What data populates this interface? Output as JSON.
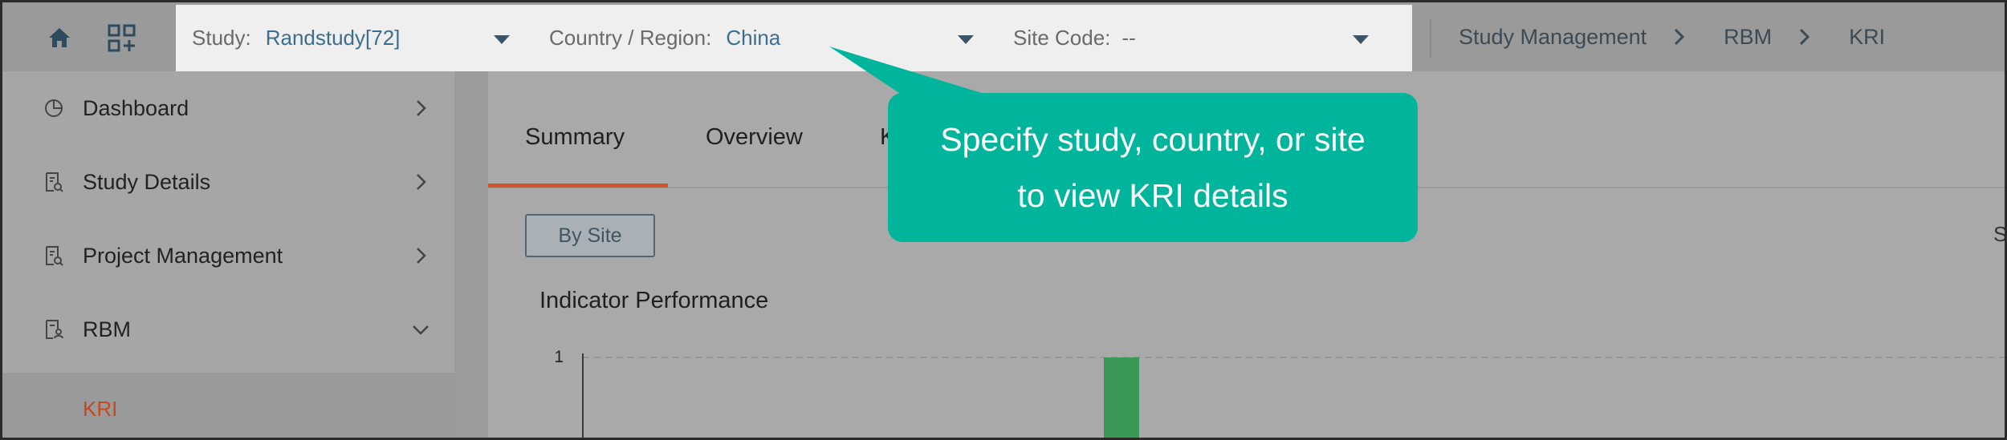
{
  "filters": {
    "study_label": "Study:",
    "study_value": "Randstudy[72]",
    "country_label": "Country / Region:",
    "country_value": "China",
    "site_label": "Site Code:",
    "site_value": "--"
  },
  "breadcrumb": [
    "Study Management",
    "RBM",
    "KRI"
  ],
  "sidebar": {
    "items": [
      {
        "label": "Dashboard",
        "icon": "pie-chart-icon",
        "expanded": false
      },
      {
        "label": "Study Details",
        "icon": "document-search-icon",
        "expanded": false
      },
      {
        "label": "Project Management",
        "icon": "document-search-icon",
        "expanded": false
      },
      {
        "label": "RBM",
        "icon": "document-user-icon",
        "expanded": true
      }
    ],
    "sub_item": "KRI"
  },
  "tabs": [
    {
      "label": "Summary",
      "active": true
    },
    {
      "label": "Overview",
      "active": false
    },
    {
      "label": "K",
      "active": false
    }
  ],
  "by_site_button": "By Site",
  "section_title": "Indicator Performance",
  "tooltip": {
    "line1": "Specify study, country, or site",
    "line2": "to view KRI details"
  },
  "edge_text": "S",
  "colors": {
    "accent": "#d3542a",
    "tooltip": "#00b59b",
    "link": "#3b6e8f",
    "bar": "#3a9a55"
  },
  "chart_data": {
    "type": "bar",
    "y_ticks": [
      "1"
    ],
    "ylim": [
      0,
      1
    ],
    "bars": [
      {
        "value": 1
      }
    ]
  }
}
